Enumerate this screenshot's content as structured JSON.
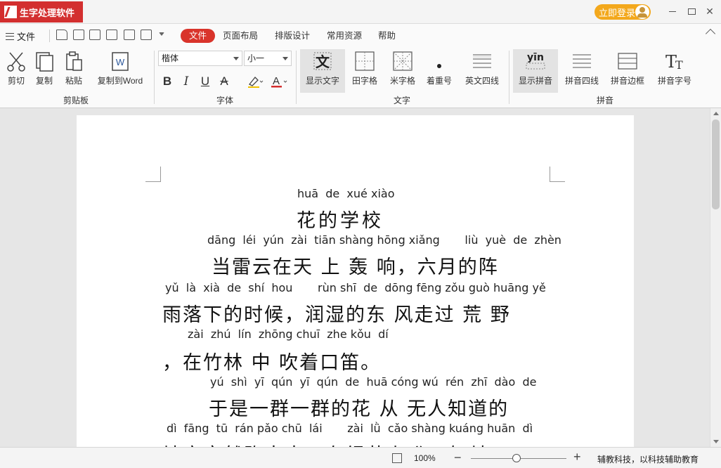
{
  "app": {
    "title": "生字处理软件",
    "login_label": "立即登录"
  },
  "menubar": {
    "file_label": "文件",
    "tabs": [
      "文件",
      "页面布局",
      "排版设计",
      "常用资源",
      "帮助"
    ]
  },
  "ribbon": {
    "clipboard": {
      "cut": "剪切",
      "copy": "复制",
      "paste": "粘贴",
      "copy_word": "复制到Word",
      "group": "剪贴板"
    },
    "font": {
      "family": "楷体",
      "size": "小一",
      "group": "字体"
    },
    "text": {
      "show_text": "显示文字",
      "tian": "田字格",
      "mi": "米字格",
      "emphasis": "着重号",
      "four_lines": "英文四线",
      "group": "文字",
      "show_text_glyph": "文"
    },
    "pinyin": {
      "show_pinyin": "显示拼音",
      "pinyin_glyph": "yīn",
      "four_lines": "拼音四线",
      "border": "拼音边框",
      "font": "拼音字号",
      "group": "拼音"
    }
  },
  "document": {
    "lines": [
      {
        "pinyin": "huā  de  xué xiào",
        "hanzi": "花的学校"
      },
      {
        "pinyin": "dāng  léi  yún  zài  tiān shàng hōng xiǎng       liù  yuè  de  zhèn",
        "hanzi": "当雷云在天 上 轰 响，六月的阵"
      },
      {
        "pinyin": "yǔ  là  xià  de  shí  hou       rùn shī  de  dōng fēng zǒu guò huāng yě",
        "hanzi": "雨落下的时候，润湿的东 风走过 荒 野"
      },
      {
        "pinyin": "zài  zhú  lín  zhōng chuī  zhe kǒu  dí",
        "hanzi": "，在竹林 中 吹着口笛。"
      },
      {
        "pinyin": "yú  shì  yī  qún  yī  qún  de  huā cóng wú  rén  zhī  dào  de",
        "hanzi": "于是一群一群的花 从 无人知道的"
      },
      {
        "pinyin": "dì  fāng  tū  rán pǎo chū  lái       zài  lǜ  cǎo shàng kuáng huān  dì",
        "hanzi": "地方突然跑出来，在绿草上 狂 欢 地"
      }
    ]
  },
  "status": {
    "zoom": "100%",
    "zoom_percent": 100,
    "text": "辅教科技，以科技辅助教育"
  }
}
